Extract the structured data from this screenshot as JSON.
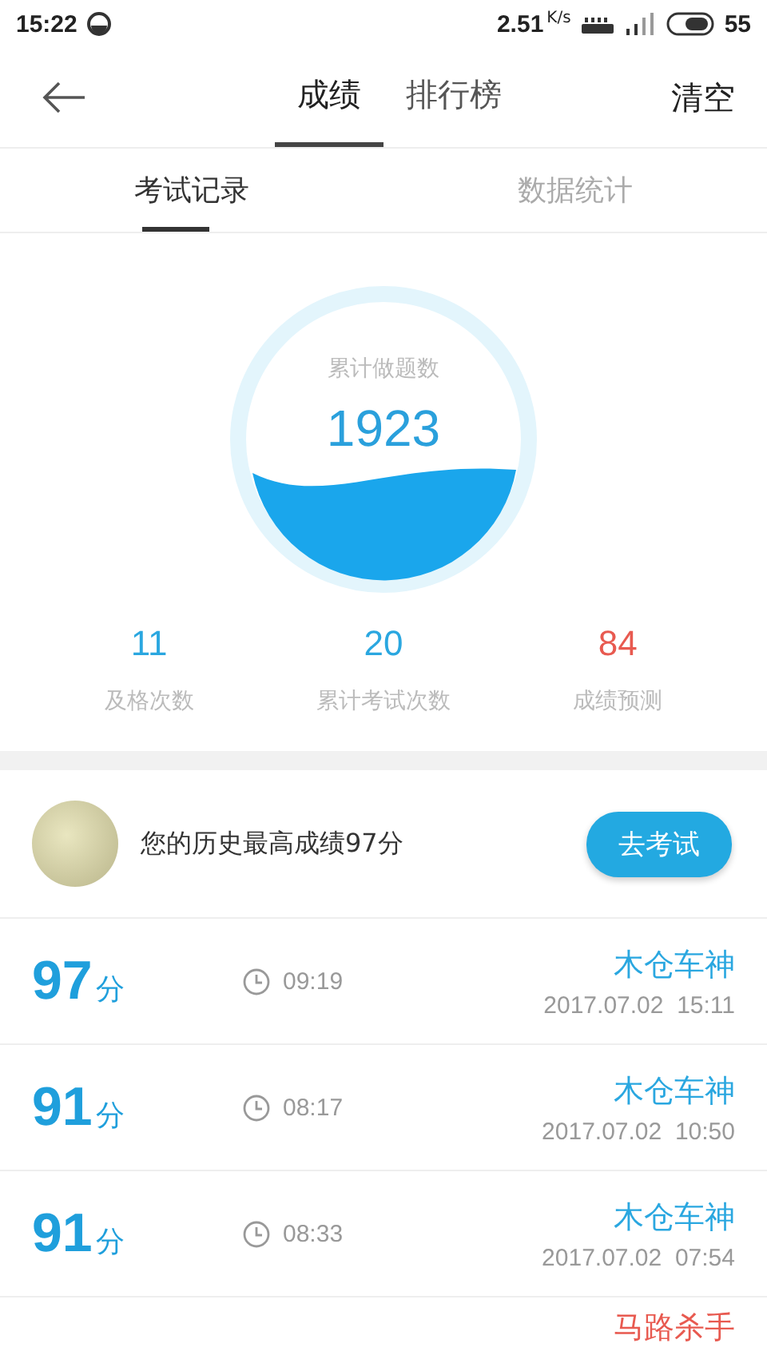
{
  "status_bar": {
    "time": "15:22",
    "speed": "2.51",
    "speed_unit": "K/s",
    "battery": "55"
  },
  "nav": {
    "tabs": [
      {
        "label": "成绩",
        "selected": true
      },
      {
        "label": "排行榜",
        "selected": false
      }
    ],
    "action": "清空"
  },
  "sub_tabs": [
    {
      "label": "考试记录",
      "selected": true
    },
    {
      "label": "数据统计",
      "selected": false
    }
  ],
  "gauge": {
    "label": "累计做题数",
    "value": "1923"
  },
  "stats": [
    {
      "value": "11",
      "label": "及格次数",
      "color": "#2aa7e0"
    },
    {
      "value": "20",
      "label": "累计考试次数",
      "color": "#2aa7e0"
    },
    {
      "value": "84",
      "label": "成绩预测",
      "color": "#e85a50"
    }
  ],
  "best": {
    "text": "您的历史最高成绩97分",
    "button": "去考试"
  },
  "records": [
    {
      "score": "97",
      "unit": "分",
      "duration": "09:19",
      "name": "木仓车神",
      "color": "#2aa7e0",
      "date": "2017.07.02  15:11"
    },
    {
      "score": "91",
      "unit": "分",
      "duration": "08:17",
      "name": "木仓车神",
      "color": "#2aa7e0",
      "date": "2017.07.02  10:50"
    },
    {
      "score": "91",
      "unit": "分",
      "duration": "08:33",
      "name": "木仓车神",
      "color": "#2aa7e0",
      "date": "2017.07.02  07:54"
    },
    {
      "name": "马路杀手",
      "color": "#e85a50"
    }
  ]
}
